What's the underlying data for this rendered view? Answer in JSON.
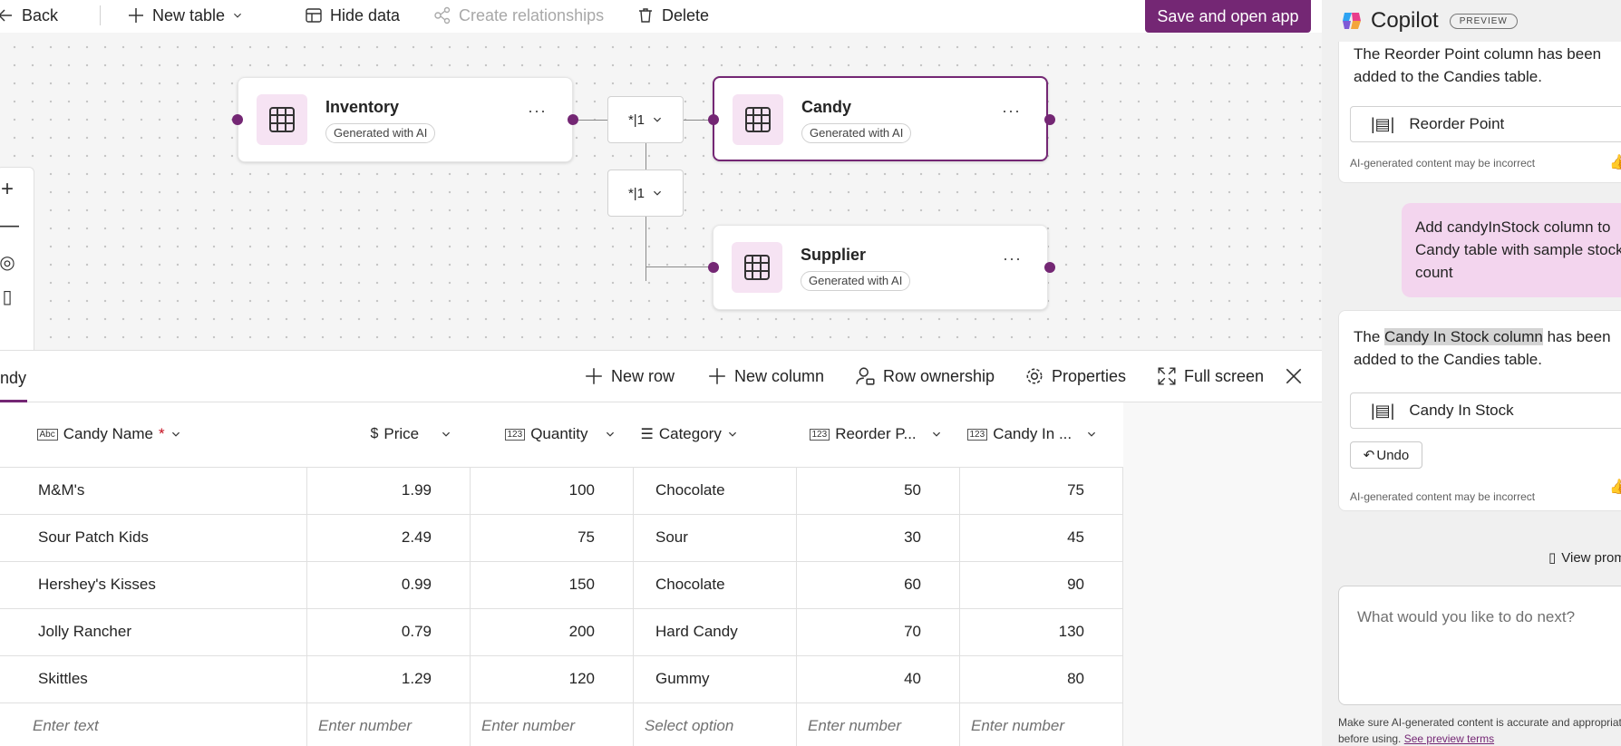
{
  "toolbar": {
    "back_label": "Back",
    "new_table_label": "New table",
    "hide_data_label": "Hide data",
    "create_relationships_label": "Create relationships",
    "delete_label": "Delete",
    "save_open_label": "Save and open app"
  },
  "canvas": {
    "entities": [
      {
        "title": "Inventory",
        "badge": "Generated with AI"
      },
      {
        "title": "Candy",
        "badge": "Generated with AI"
      },
      {
        "title": "Supplier",
        "badge": "Generated with AI"
      }
    ],
    "relationship_label": "*|1",
    "more_label": "···"
  },
  "grid_bar": {
    "tab_label": "ndy",
    "new_row": "New row",
    "new_column": "New column",
    "row_ownership": "Row ownership",
    "properties": "Properties",
    "full_screen": "Full screen"
  },
  "table": {
    "columns": [
      {
        "label": "Candy Name",
        "icon": "Abc",
        "required": "*"
      },
      {
        "label": "Price",
        "icon": "currency"
      },
      {
        "label": "Quantity",
        "icon": "123"
      },
      {
        "label": "Category",
        "icon": "list"
      },
      {
        "label": "Reorder P...",
        "icon": "123"
      },
      {
        "label": "Candy In ...",
        "icon": "123"
      }
    ],
    "rows": [
      [
        "M&M's",
        "1.99",
        "100",
        "Chocolate",
        "50",
        "75"
      ],
      [
        "Sour Patch Kids",
        "2.49",
        "75",
        "Sour",
        "30",
        "45"
      ],
      [
        "Hershey's Kisses",
        "0.99",
        "150",
        "Chocolate",
        "60",
        "90"
      ],
      [
        "Jolly Rancher",
        "0.79",
        "200",
        "Hard Candy",
        "70",
        "130"
      ],
      [
        "Skittles",
        "1.29",
        "120",
        "Gummy",
        "40",
        "80"
      ]
    ],
    "entry_row": [
      "Enter text",
      "Enter number",
      "Enter number",
      "Select option",
      "Enter number",
      "Enter number"
    ]
  },
  "copilot": {
    "title": "Copilot",
    "preview_badge": "PREVIEW",
    "msg1_text": "The Reorder Point column has been added to the Candies table.",
    "msg1_chip": "Reorder Point",
    "disclaimer": "AI-generated content may be incorrect",
    "user_message": "Add candyInStock column to Candy table with sample stock count",
    "msg2_prefix": "The ",
    "msg2_highlight": "Candy In Stock column",
    "msg2_suffix": " has been added to the Candies table.",
    "msg2_chip": "Candy In Stock",
    "undo_label": "Undo",
    "view_prompts": "View prompts",
    "prompt_placeholder": "What would you like to do next?",
    "footer_text": "Make sure AI-generated content is accurate and appropriate before using.",
    "footer_link": "See preview terms"
  }
}
